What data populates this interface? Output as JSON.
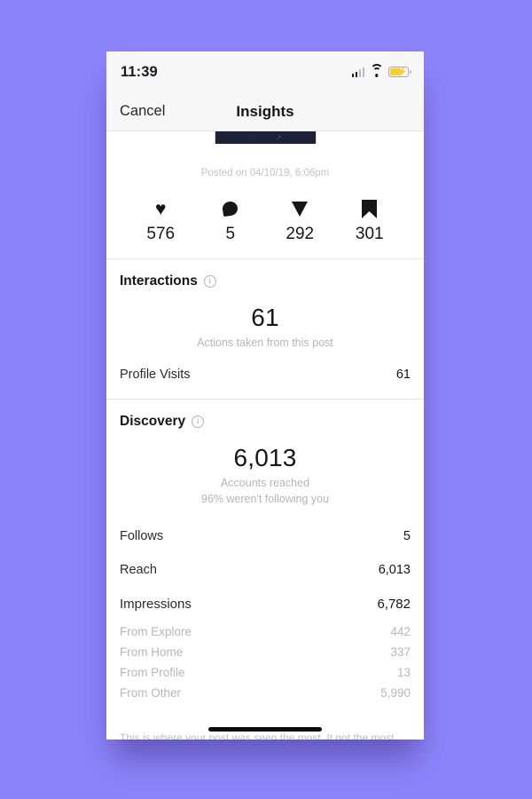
{
  "background_color": "#8d84fd",
  "statusbar": {
    "time": "11:39",
    "signal_icon": "cellular-signal-icon",
    "wifi_icon": "wifi-icon",
    "battery_icon": "battery-charging-icon",
    "battery_bolt": "⚡"
  },
  "navbar": {
    "cancel_label": "Cancel",
    "title": "Insights"
  },
  "post": {
    "thumb_heart_icon": "♡",
    "thumb_share_icon": "↗",
    "posted_on": "Posted on 04/10/19, 6:06pm"
  },
  "engagement": [
    {
      "icon": "heart-icon",
      "glyph": "♥",
      "value": "576"
    },
    {
      "icon": "comment-icon",
      "glyph": "",
      "value": "5"
    },
    {
      "icon": "send-icon",
      "glyph": "",
      "value": "292"
    },
    {
      "icon": "bookmark-icon",
      "glyph": "",
      "value": "301"
    }
  ],
  "interactions": {
    "title": "Interactions",
    "info_icon": "info-icon",
    "info_glyph": "i",
    "hero_value": "61",
    "hero_caption": "Actions taken from this post",
    "rows": [
      {
        "label": "Profile Visits",
        "value": "61"
      }
    ]
  },
  "discovery": {
    "title": "Discovery",
    "info_icon": "info-icon",
    "info_glyph": "i",
    "hero_value": "6,013",
    "hero_caption_line1": "Accounts reached",
    "hero_caption_line2": "96% weren't following you",
    "follows": {
      "label": "Follows",
      "value": "5"
    },
    "reach": {
      "label": "Reach",
      "value": "6,013"
    },
    "impressions": {
      "label": "Impressions",
      "value": "6,782"
    },
    "impression_sources": [
      {
        "label": "From Explore",
        "value": "442"
      },
      {
        "label": "From Home",
        "value": "337"
      },
      {
        "label": "From Profile",
        "value": "13"
      },
      {
        "label": "From Other",
        "value": "5,990"
      }
    ]
  },
  "footnote": "This is where your post was seen the most. It got the most impressions from Explore, Home and Profile."
}
